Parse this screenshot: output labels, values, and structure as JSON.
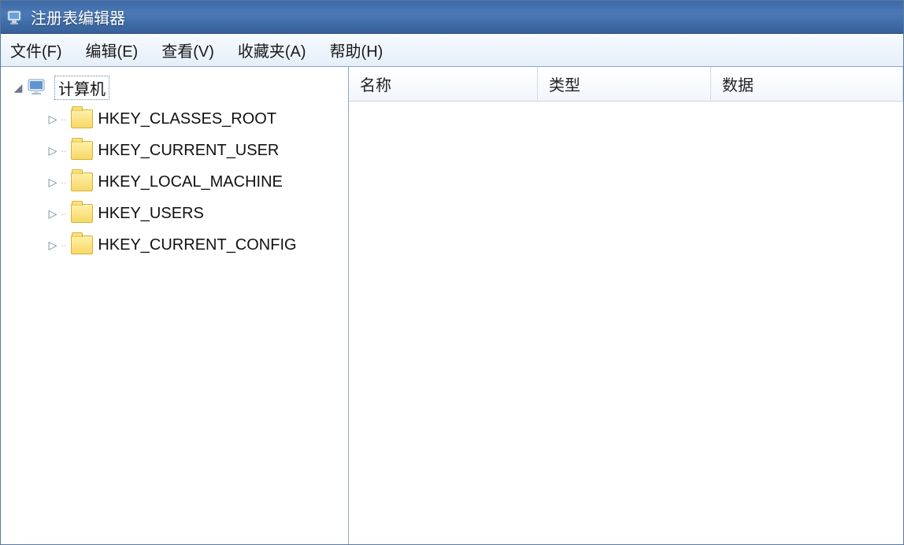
{
  "window": {
    "title": "注册表编辑器"
  },
  "menu": {
    "file": "文件(F)",
    "edit": "编辑(E)",
    "view": "查看(V)",
    "favorites": "收藏夹(A)",
    "help": "帮助(H)"
  },
  "tree": {
    "root": "计算机",
    "items": [
      {
        "label": "HKEY_CLASSES_ROOT"
      },
      {
        "label": "HKEY_CURRENT_USER"
      },
      {
        "label": "HKEY_LOCAL_MACHINE"
      },
      {
        "label": "HKEY_USERS"
      },
      {
        "label": "HKEY_CURRENT_CONFIG"
      }
    ]
  },
  "columns": {
    "name": "名称",
    "type": "类型",
    "data": "数据"
  }
}
